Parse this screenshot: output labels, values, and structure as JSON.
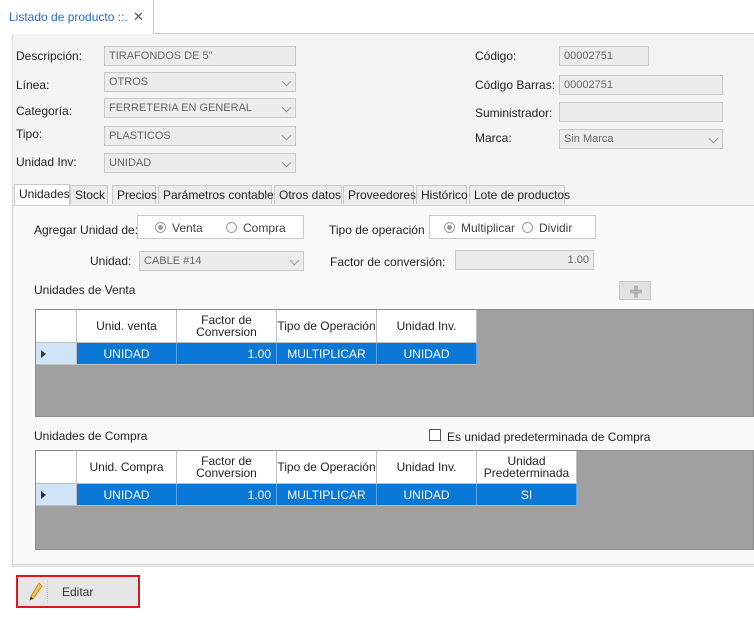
{
  "window": {
    "tab_title": "Listado de producto ::.",
    "close_glyph": "✕"
  },
  "form": {
    "descripcion": {
      "label": "Descripción:",
      "value": "TIRAFONDOS DE 5\""
    },
    "linea": {
      "label": "Línea:",
      "value": "OTROS"
    },
    "categoria": {
      "label": "Categoría:",
      "value": "FERRETERIA EN GENERAL"
    },
    "tipo": {
      "label": "Tipo:",
      "value": "PLASTICOS"
    },
    "unidad_inv": {
      "label": "Unidad Inv:",
      "value": "UNIDAD"
    },
    "codigo": {
      "label": "Código:",
      "value": "00002751"
    },
    "codigo_barras": {
      "label": "Código Barras:",
      "value": "00002751"
    },
    "suministrador": {
      "label": "Suministrador:",
      "value": ""
    },
    "marca": {
      "label": "Marca:",
      "value": "Sin Marca"
    }
  },
  "tabs": [
    "Unidades",
    "Stock",
    "Precios",
    "Parámetros contables",
    "Otros datos",
    "Proveedores",
    "Histórico",
    "Lote de productos"
  ],
  "unidades": {
    "agregar_label": "Agregar Unidad de:",
    "agregar_options": [
      "Venta",
      "Compra"
    ],
    "agregar_selected": "Venta",
    "tipo_op_label": "Tipo de operación",
    "tipo_op_options": [
      "Multiplicar",
      "Dividir"
    ],
    "tipo_op_selected": "Multiplicar",
    "unidad_label": "Unidad:",
    "unidad_value": "CABLE #14",
    "factor_label": "Factor de conversión:",
    "factor_value": "1.00",
    "venta_title": "Unidades de Venta",
    "compra_title": "Unidades de Compra",
    "predeterminada_label": "Es unidad predeterminada de Compra",
    "predeterminada_checked": false,
    "venta_grid": {
      "headers": [
        "Unid. venta",
        "Factor de Conversion",
        "Tipo de Operación",
        "Unidad Inv."
      ],
      "rows": [
        [
          "UNIDAD",
          "1.00",
          "MULTIPLICAR",
          "UNIDAD"
        ]
      ]
    },
    "compra_grid": {
      "headers": [
        "Unid. Compra",
        "Factor de Conversion",
        "Tipo de Operación",
        "Unidad Inv.",
        "Unidad Predeterminada"
      ],
      "rows": [
        [
          "UNIDAD",
          "1.00",
          "MULTIPLICAR",
          "UNIDAD",
          "SI"
        ]
      ]
    }
  },
  "actions": {
    "edit_label": "Editar"
  },
  "colors": {
    "selection": "#0a78d7",
    "highlight_border": "#e0161b",
    "tab_title": "#2b6cc4"
  }
}
